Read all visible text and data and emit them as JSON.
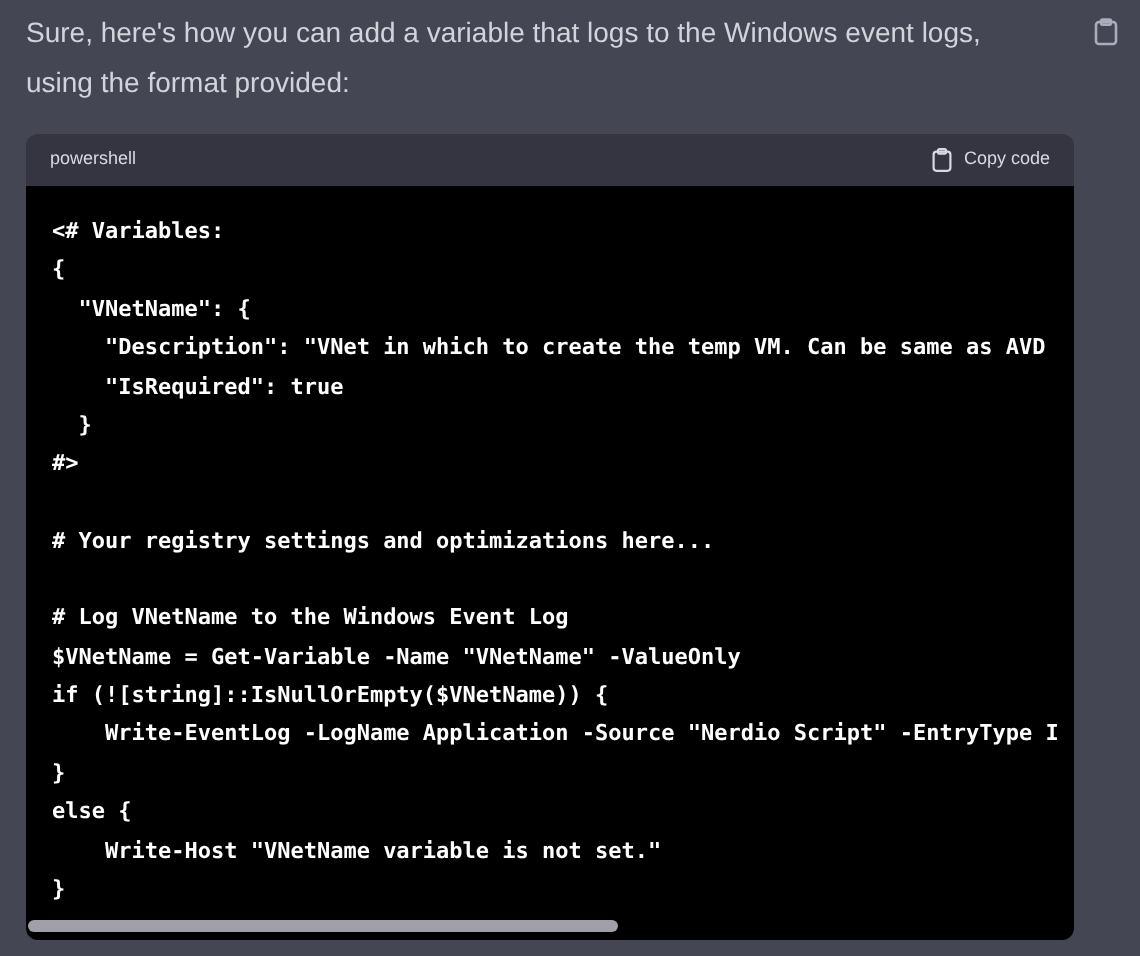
{
  "message": {
    "text": "Sure, here's how you can add a variable that logs to the Windows event logs, using the format provided:"
  },
  "code_block": {
    "language": "powershell",
    "copy_label": "Copy code",
    "blocks": [
      [
        "<# Variables:",
        "{",
        "  \"VNetName\": {",
        "    \"Description\": \"VNet in which to create the temp VM. Can be same as AVD",
        "    \"IsRequired\": true",
        "  }",
        "#>"
      ],
      [
        "# Your registry settings and optimizations here..."
      ],
      [
        "# Log VNetName to the Windows Event Log",
        "$VNetName = Get-Variable -Name \"VNetName\" -ValueOnly",
        "if (![string]::IsNullOrEmpty($VNetName)) {",
        "    Write-EventLog -LogName Application -Source \"Nerdio Script\" -EntryType I",
        "}",
        "else {",
        "    Write-Host \"VNetName variable is not set.\"",
        "}"
      ]
    ]
  }
}
